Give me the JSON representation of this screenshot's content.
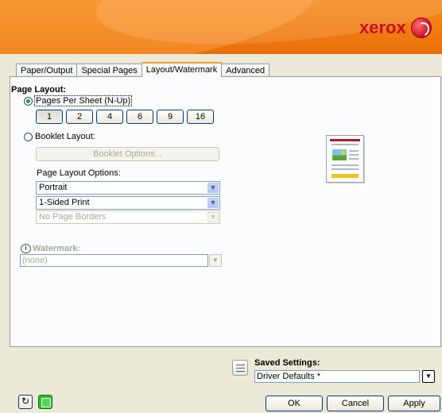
{
  "brand": {
    "name": "xerox"
  },
  "tabs": [
    {
      "label": "Paper/Output"
    },
    {
      "label": "Special Pages"
    },
    {
      "label": "Layout/Watermark"
    },
    {
      "label": "Advanced"
    }
  ],
  "active_tab": "Layout/Watermark",
  "page_layout": {
    "title": "Page Layout:",
    "pages_per_sheet_label": "Pages Per Sheet (N-Up)",
    "pages_per_sheet_selected": true,
    "nup_options": [
      "1",
      "2",
      "4",
      "6",
      "9",
      "16"
    ],
    "nup_selected": "1",
    "booklet_label": "Booklet Layout:",
    "booklet_selected": false,
    "booklet_options_label": "Booklet Options...",
    "options_label": "Page Layout Options:",
    "orientation": "Portrait",
    "sides": "1-Sided Print",
    "borders": "No Page Borders"
  },
  "watermark": {
    "title": "Watermark:",
    "value": "(none)"
  },
  "saved_settings": {
    "title": "Saved Settings:",
    "value": "Driver Defaults *"
  },
  "buttons": {
    "ok": "OK",
    "cancel": "Cancel",
    "apply": "Apply"
  },
  "colors": {
    "banner_orange": "#f07d10",
    "brand_red": "#c8102e",
    "active_tab_accent": "#f0a030"
  },
  "icons": [
    "xerox-logo-icon",
    "radio-selected-icon",
    "radio-unselected-icon",
    "dropdown-arrow-icon",
    "watermark-info-icon",
    "page-preview-icon",
    "saved-settings-icon",
    "restore-defaults-icon",
    "status-icon"
  ]
}
